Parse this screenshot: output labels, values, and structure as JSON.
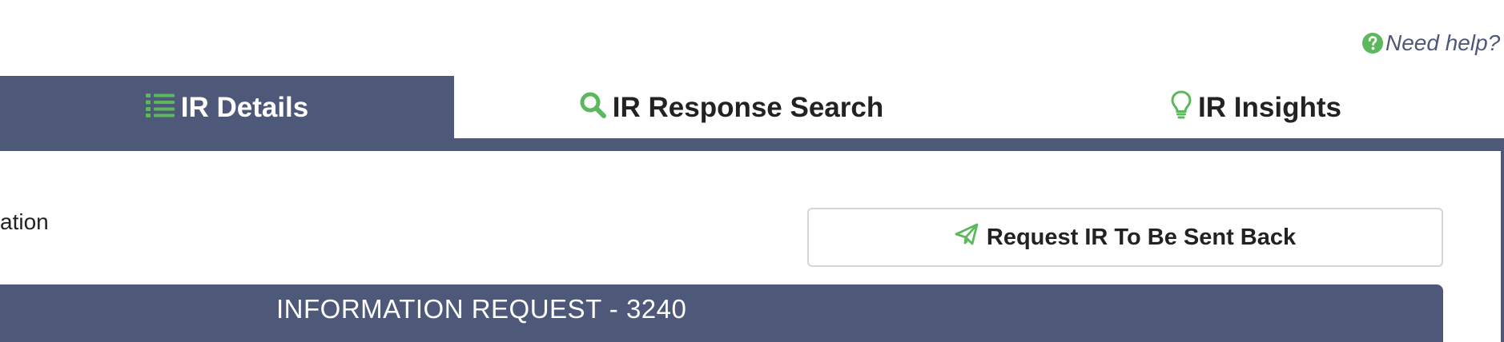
{
  "help": {
    "label": "Need help?",
    "icon": "question-circle-icon"
  },
  "tabs": [
    {
      "label": "IR Details",
      "icon": "list-icon",
      "active": true
    },
    {
      "label": "IR Response Search",
      "icon": "search-icon",
      "active": false
    },
    {
      "label": "IR Insights",
      "icon": "lightbulb-icon",
      "active": false
    }
  ],
  "content": {
    "partial_label": "ation",
    "send_back_button": {
      "label": "Request IR To Be Sent Back",
      "icon": "paper-plane-icon"
    },
    "header_title": "INFORMATION REQUEST - 3240"
  },
  "colors": {
    "primary": "#4e5878",
    "accent_green": "#5cb85c",
    "text_dark": "#222222",
    "help_text": "#4e5878"
  }
}
